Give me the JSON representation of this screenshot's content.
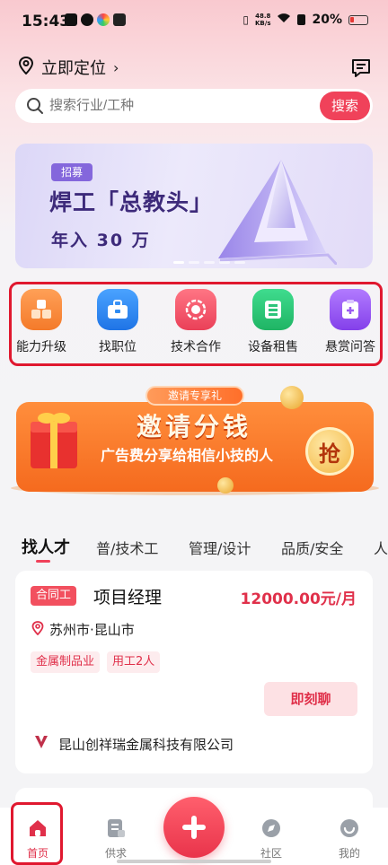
{
  "status_bar": {
    "time": "15:43",
    "net_speed_value": "48.8",
    "net_speed_unit": "KB/s",
    "battery": "20%"
  },
  "location": {
    "label": "立即定位"
  },
  "search": {
    "placeholder": "搜索行业/工种",
    "button": "搜索"
  },
  "banner": {
    "tag": "招募",
    "title": "焊工「总教头」",
    "subtitle": "年入 30 万",
    "dots": 5,
    "active_dot": 0
  },
  "quick_menu": [
    {
      "label": "能力升级",
      "icon": "cubes-icon",
      "color": "#f8883a"
    },
    {
      "label": "找职位",
      "icon": "briefcase-icon",
      "color": "#2f8cf2"
    },
    {
      "label": "技术合作",
      "icon": "cooperation-icon",
      "color": "#f2566a"
    },
    {
      "label": "设备租售",
      "icon": "rent-icon",
      "color": "#2dc47a"
    },
    {
      "label": "悬赏问答",
      "icon": "reward-qa-icon",
      "color": "#9b5cf0"
    }
  ],
  "invite_banner": {
    "ribbon": "邀请专享礼",
    "title": "邀请分钱",
    "subtitle": "广告费分享给相信小技的人",
    "button": "抢"
  },
  "tabs": [
    {
      "label": "找人才",
      "active": true
    },
    {
      "label": "普/技术工",
      "active": false
    },
    {
      "label": "管理/设计",
      "active": false
    },
    {
      "label": "品质/安全",
      "active": false
    },
    {
      "label": "人",
      "active": false
    }
  ],
  "job_card": {
    "contract_tag": "合同工",
    "title": "项目经理",
    "salary": "12000.00元/月",
    "location": "苏州市·昆山市",
    "tags": [
      "金属制品业",
      "用工2人"
    ],
    "chat_button": "即刻聊",
    "company": "昆山创祥瑞金属科技有限公司"
  },
  "bottom_nav": [
    {
      "label": "首页",
      "icon": "home-icon",
      "active": true
    },
    {
      "label": "供求",
      "icon": "supply-demand-icon",
      "active": false
    },
    {
      "label": "",
      "icon": "plus-icon",
      "active": false
    },
    {
      "label": "社区",
      "icon": "compass-icon",
      "active": false
    },
    {
      "label": "我的",
      "icon": "profile-icon",
      "active": false
    }
  ],
  "colors": {
    "accent": "#f0425a",
    "highlight_border": "#e0182f"
  }
}
